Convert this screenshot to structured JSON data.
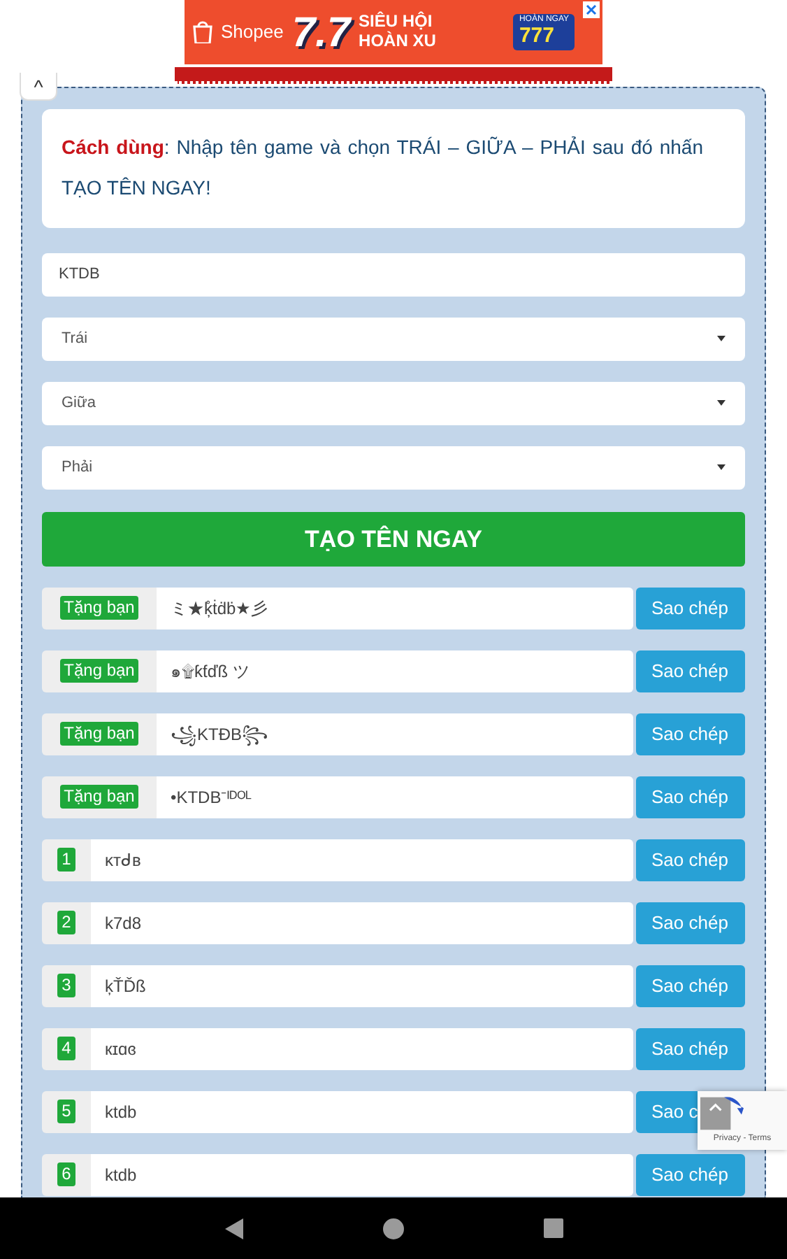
{
  "ad": {
    "brand": "Shopee",
    "headline": "7.7",
    "line_1": "SIÊU HỘI",
    "line_2": "HOÀN XU",
    "promo_label": "HOÀN NGAY",
    "promo_value": "777"
  },
  "collapse_toggle": {
    "symbol": "^"
  },
  "instructions": {
    "label": "Cách dùng",
    "text": ": Nhập tên game và chọn TRÁI – GIỮA – PHẢI sau đó nhấn TẠO TÊN NGAY!"
  },
  "name_input": {
    "value": "KTDB"
  },
  "selects": [
    {
      "value": "Trái"
    },
    {
      "value": "Giữa"
    },
    {
      "value": "Phải"
    }
  ],
  "generate_button": "TẠO TÊN NGAY",
  "results": [
    {
      "kind": "gift",
      "badge": "Tặng bạn",
      "value": "ミ★ķ̊ṫḋḃ★彡",
      "copy_label": "Sao chép"
    },
    {
      "kind": "gift",
      "badge": "Tặng bạn",
      "value": "๑۩ƙƭďß ツ",
      "copy_label": "Sao chép"
    },
    {
      "kind": "gift",
      "badge": "Tặng bạn",
      "value": "꧁KTĐB꧂",
      "copy_label": "Sao chép"
    },
    {
      "kind": "gift",
      "badge": "Tặng bạn",
      "value": "•KTDB⁻ᴵᴰᴼᴸ",
      "copy_label": "Sao chép"
    },
    {
      "kind": "number",
      "badge": "1",
      "value": "ĸтᑯв",
      "copy_label": "Sao chép"
    },
    {
      "kind": "number",
      "badge": "2",
      "value": "k7d8",
      "copy_label": "Sao chép"
    },
    {
      "kind": "number",
      "badge": "3",
      "value": "ķŤĎß",
      "copy_label": "Sao chép"
    },
    {
      "kind": "number",
      "badge": "4",
      "value": "кɪɑɞ",
      "copy_label": "Sao chép"
    },
    {
      "kind": "number",
      "badge": "5",
      "value": "ktdb",
      "copy_label": "Sao c",
      "copy_covered": true
    },
    {
      "kind": "number",
      "badge": "6",
      "value": "ktdb",
      "copy_label": "Sao chép"
    }
  ],
  "recaptcha": {
    "text": "Privacy - Terms"
  }
}
